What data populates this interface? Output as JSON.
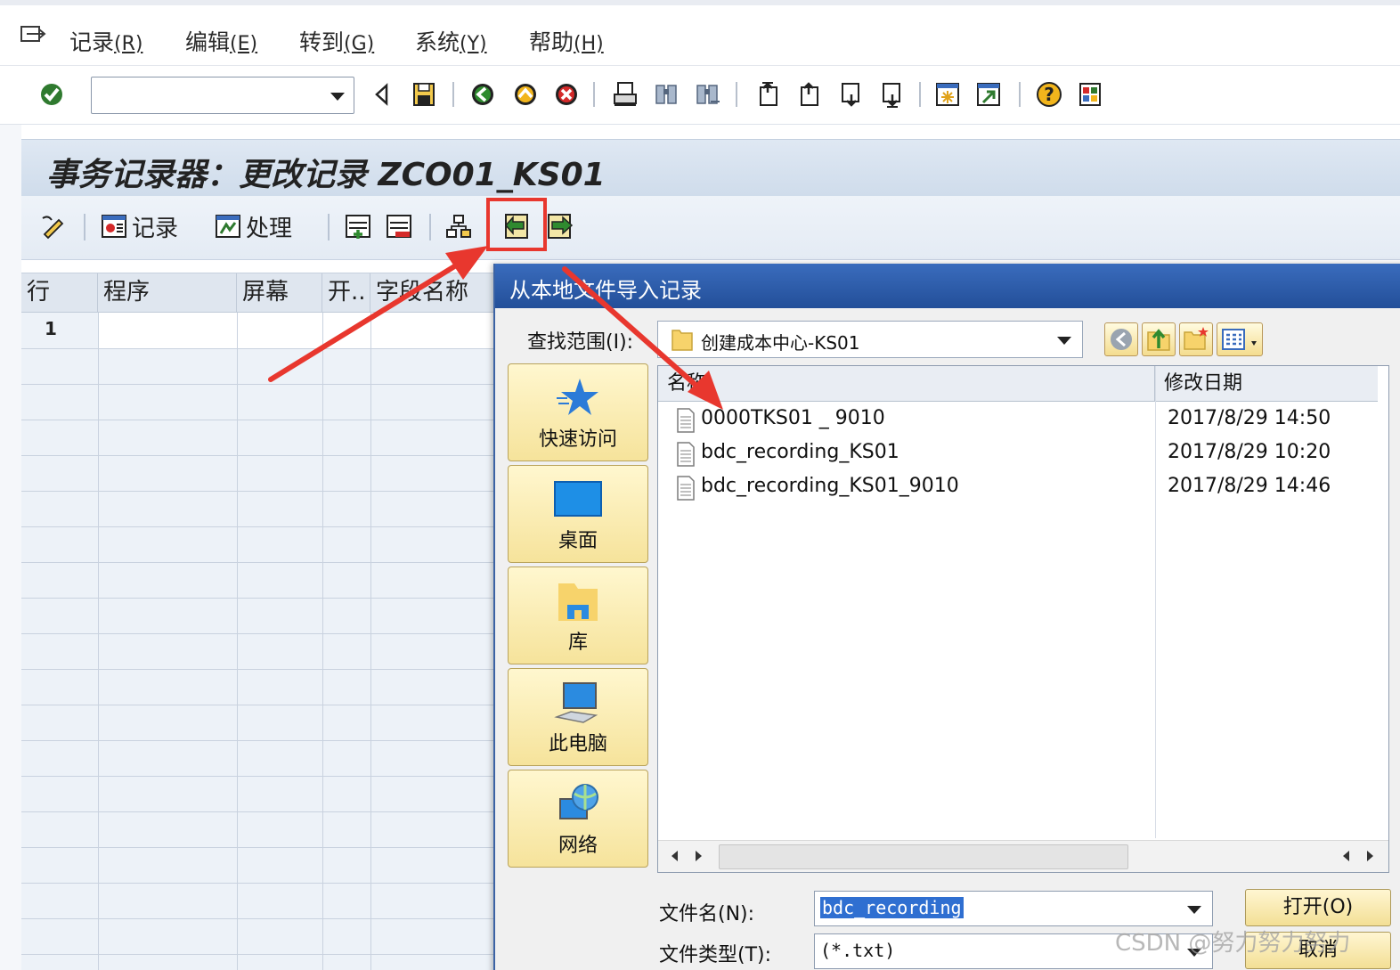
{
  "menu": {
    "items": [
      {
        "label": "记录",
        "accel": "(R)"
      },
      {
        "label": "编辑",
        "accel": "(E)"
      },
      {
        "label": "转到",
        "accel": "(G)"
      },
      {
        "label": "系统",
        "accel": "(Y)"
      },
      {
        "label": "帮助",
        "accel": "(H)"
      }
    ]
  },
  "command_field": {
    "value": "",
    "placeholder": ""
  },
  "page_title": "事务记录器：更改记录 ZCO01_KS01",
  "app_toolbar": {
    "record_label": "记录",
    "process_label": "处理"
  },
  "grid": {
    "headers": [
      "行",
      "程序",
      "屏幕",
      "开..",
      "字段名称"
    ],
    "first_row_number": "1"
  },
  "dialog": {
    "title": "从本地文件导入记录",
    "look_in_label": "查找范围(I):",
    "look_in_value": "创建成本中心-KS01",
    "places": [
      "快速访问",
      "桌面",
      "库",
      "此电脑",
      "网络"
    ],
    "columns": [
      "名称",
      "修改日期"
    ],
    "files": [
      {
        "name": "0000TKS01 _ 9010",
        "date": "2017/8/29 14:50"
      },
      {
        "name": "bdc_recording_KS01",
        "date": "2017/8/29 10:20"
      },
      {
        "name": "bdc_recording_KS01_9010",
        "date": "2017/8/29 14:46"
      }
    ],
    "file_name_label": "文件名(N):",
    "file_name_value": "bdc_recording",
    "file_type_label": "文件类型(T):",
    "file_type_value": "(*.txt)",
    "open_label": "打开(O)",
    "cancel_label": "取消"
  },
  "colors": {
    "annotation_red": "#e8372e",
    "dialog_title_blue": "#2f5ca6",
    "button_gold": "#f3df95"
  },
  "watermark": "CSDN @努力努力努力"
}
